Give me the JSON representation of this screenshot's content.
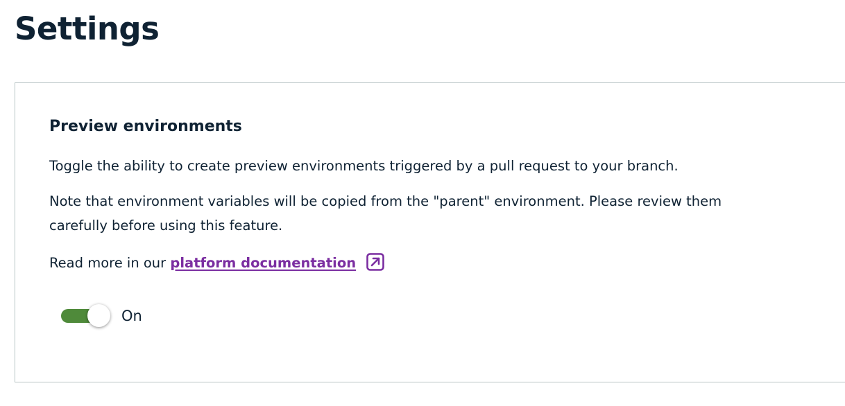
{
  "page": {
    "title": "Settings"
  },
  "preview_environments": {
    "title": "Preview environments",
    "description": "Toggle the ability to create preview environments triggered by a pull request to your branch.",
    "note": "Note that environment variables will be copied from the \"parent\" environment. Please review them carefully before using this feature.",
    "read_more_prefix": "Read more in our ",
    "link_text": "platform documentation",
    "link_icon": "external-link-icon",
    "toggle": {
      "state": true,
      "label": "On"
    }
  },
  "colors": {
    "text": "#0f2233",
    "link": "#7b2ea1",
    "toggle_on": "#4f8a3a",
    "card_border": "#b7c3c4"
  }
}
